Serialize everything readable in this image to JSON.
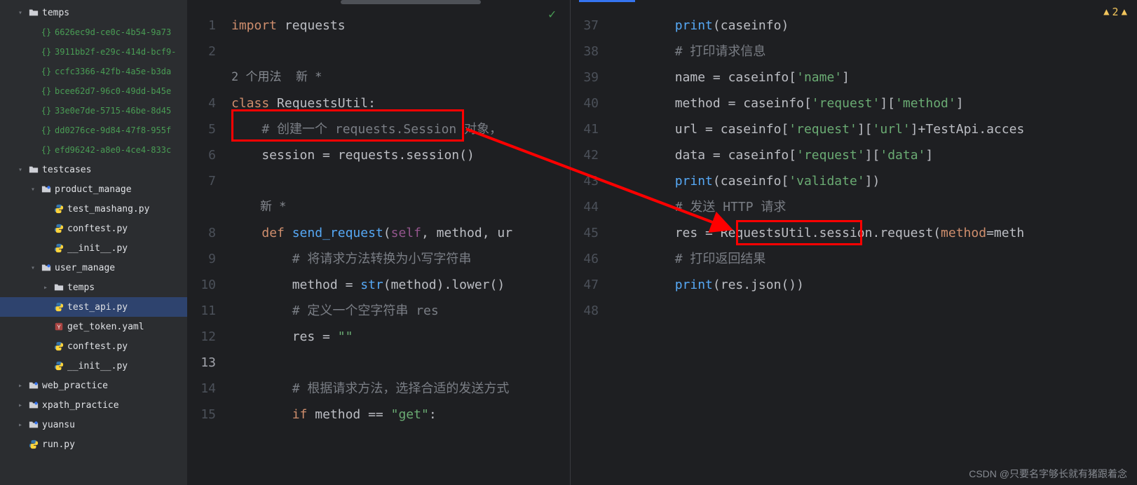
{
  "sidebar": {
    "nodes": [
      {
        "indent": 1,
        "chev": "down",
        "icon": "folder",
        "label": "temps"
      },
      {
        "indent": 2,
        "chev": "",
        "icon": "scratch",
        "label": "6626ec9d-ce0c-4b54-9a73"
      },
      {
        "indent": 2,
        "chev": "",
        "icon": "scratch",
        "label": "3911bb2f-e29c-414d-bcf9-"
      },
      {
        "indent": 2,
        "chev": "",
        "icon": "scratch",
        "label": "ccfc3366-42fb-4a5e-b3da"
      },
      {
        "indent": 2,
        "chev": "",
        "icon": "scratch",
        "label": "bcee62d7-96c0-49dd-b45e"
      },
      {
        "indent": 2,
        "chev": "",
        "icon": "scratch",
        "label": "33e0e7de-5715-46be-8d45"
      },
      {
        "indent": 2,
        "chev": "",
        "icon": "scratch",
        "label": "dd0276ce-9d84-47f8-955f"
      },
      {
        "indent": 2,
        "chev": "",
        "icon": "scratch",
        "label": "efd96242-a8e0-4ce4-833c"
      },
      {
        "indent": 1,
        "chev": "down",
        "icon": "folder",
        "label": "testcases"
      },
      {
        "indent": 2,
        "chev": "down",
        "icon": "pkg",
        "label": "product_manage"
      },
      {
        "indent": 3,
        "chev": "",
        "icon": "py",
        "label": "test_mashang.py"
      },
      {
        "indent": 3,
        "chev": "",
        "icon": "py",
        "label": "conftest.py"
      },
      {
        "indent": 3,
        "chev": "",
        "icon": "py",
        "label": "__init__.py"
      },
      {
        "indent": 2,
        "chev": "down",
        "icon": "pkg",
        "label": "user_manage"
      },
      {
        "indent": 3,
        "chev": "right",
        "icon": "folder",
        "label": "temps"
      },
      {
        "indent": 3,
        "chev": "",
        "icon": "py",
        "label": "test_api.py",
        "selected": true
      },
      {
        "indent": 3,
        "chev": "",
        "icon": "yaml",
        "label": "get_token.yaml"
      },
      {
        "indent": 3,
        "chev": "",
        "icon": "py",
        "label": "conftest.py"
      },
      {
        "indent": 3,
        "chev": "",
        "icon": "py",
        "label": "__init__.py"
      },
      {
        "indent": 1,
        "chev": "right",
        "icon": "pkg",
        "label": "web_practice"
      },
      {
        "indent": 1,
        "chev": "right",
        "icon": "pkg",
        "label": "xpath_practice"
      },
      {
        "indent": 1,
        "chev": "right",
        "icon": "pkg",
        "label": "yuansu"
      },
      {
        "indent": 1,
        "chev": "",
        "icon": "py",
        "label": "run.py"
      }
    ]
  },
  "left_editor": {
    "line_start": 1,
    "current_line": 13,
    "lines": [
      {
        "n": 1,
        "tokens": [
          [
            "kw",
            "import"
          ],
          [
            "id",
            " requests"
          ]
        ]
      },
      {
        "n": 2,
        "tokens": []
      },
      {
        "n": 0,
        "inlay": "2 个用法  新 *"
      },
      {
        "n": 4,
        "tokens": [
          [
            "kw",
            "class"
          ],
          [
            "id",
            " RequestsUtil:"
          ]
        ]
      },
      {
        "n": 5,
        "tokens": [
          [
            "id",
            "    "
          ],
          [
            "cm",
            "# 创建一个 requests.Session 对象，"
          ]
        ]
      },
      {
        "n": 6,
        "tokens": [
          [
            "id",
            "    session "
          ],
          [
            "op",
            "="
          ],
          [
            "id",
            " requests"
          ],
          [
            "op",
            "."
          ],
          [
            "id",
            "session"
          ],
          [
            "op",
            "()"
          ]
        ]
      },
      {
        "n": 7,
        "tokens": []
      },
      {
        "n": 0,
        "inlay": "    新 *"
      },
      {
        "n": 8,
        "tokens": [
          [
            "id",
            "    "
          ],
          [
            "kw",
            "def "
          ],
          [
            "fn",
            "send_request"
          ],
          [
            "op",
            "("
          ],
          [
            "self",
            "self"
          ],
          [
            "op",
            ", "
          ],
          [
            "id",
            "method"
          ],
          [
            "op",
            ", "
          ],
          [
            "id",
            "ur"
          ]
        ]
      },
      {
        "n": 9,
        "tokens": [
          [
            "id",
            "        "
          ],
          [
            "cm",
            "# 将请求方法转换为小写字符串"
          ]
        ]
      },
      {
        "n": 10,
        "tokens": [
          [
            "id",
            "        method "
          ],
          [
            "op",
            "="
          ],
          [
            "id",
            " "
          ],
          [
            "fn",
            "str"
          ],
          [
            "op",
            "("
          ],
          [
            "id",
            "method"
          ],
          [
            "op",
            ")."
          ],
          [
            "id",
            "lower"
          ],
          [
            "op",
            "()"
          ]
        ]
      },
      {
        "n": 11,
        "tokens": [
          [
            "id",
            "        "
          ],
          [
            "cm",
            "# 定义一个空字符串 res"
          ]
        ]
      },
      {
        "n": 12,
        "tokens": [
          [
            "id",
            "        res "
          ],
          [
            "op",
            "="
          ],
          [
            "id",
            " "
          ],
          [
            "str",
            "\"\""
          ]
        ]
      },
      {
        "n": 13,
        "tokens": []
      },
      {
        "n": 14,
        "tokens": [
          [
            "id",
            "        "
          ],
          [
            "cm",
            "# 根据请求方法，选择合适的发送方式"
          ]
        ]
      },
      {
        "n": 15,
        "tokens": [
          [
            "id",
            "        "
          ],
          [
            "kw",
            "if"
          ],
          [
            "id",
            " method "
          ],
          [
            "op",
            "=="
          ],
          [
            "id",
            " "
          ],
          [
            "str",
            "\"get\""
          ],
          [
            "op",
            ":"
          ]
        ]
      }
    ]
  },
  "right_editor": {
    "warning_count": "2",
    "lines": [
      {
        "n": 37,
        "tokens": [
          [
            "id",
            "        "
          ],
          [
            "fn",
            "print"
          ],
          [
            "op",
            "("
          ],
          [
            "id",
            "caseinfo"
          ],
          [
            "op",
            ")"
          ]
        ]
      },
      {
        "n": 38,
        "tokens": [
          [
            "id",
            "        "
          ],
          [
            "cm",
            "# 打印请求信息"
          ]
        ]
      },
      {
        "n": 39,
        "tokens": [
          [
            "id",
            "        "
          ],
          [
            "id",
            "name"
          ],
          [
            "op",
            " = "
          ],
          [
            "id",
            "caseinfo"
          ],
          [
            "op",
            "["
          ],
          [
            "str",
            "'name'"
          ],
          [
            "op",
            "]"
          ]
        ]
      },
      {
        "n": 40,
        "tokens": [
          [
            "id",
            "        "
          ],
          [
            "id",
            "method"
          ],
          [
            "op",
            " = "
          ],
          [
            "id",
            "caseinfo"
          ],
          [
            "op",
            "["
          ],
          [
            "str",
            "'request'"
          ],
          [
            "op",
            "]["
          ],
          [
            "str",
            "'method'"
          ],
          [
            "op",
            "]"
          ]
        ]
      },
      {
        "n": 41,
        "tokens": [
          [
            "id",
            "        "
          ],
          [
            "id",
            "url"
          ],
          [
            "op",
            " = "
          ],
          [
            "id",
            "caseinfo"
          ],
          [
            "op",
            "["
          ],
          [
            "str",
            "'request'"
          ],
          [
            "op",
            "]["
          ],
          [
            "str",
            "'url'"
          ],
          [
            "op",
            "]+"
          ],
          [
            "id",
            "TestApi"
          ],
          [
            "op",
            "."
          ],
          [
            "id",
            "acces"
          ]
        ]
      },
      {
        "n": 42,
        "tokens": [
          [
            "id",
            "        "
          ],
          [
            "id",
            "data"
          ],
          [
            "op",
            " = "
          ],
          [
            "id",
            "caseinfo"
          ],
          [
            "op",
            "["
          ],
          [
            "str",
            "'request'"
          ],
          [
            "op",
            "]["
          ],
          [
            "str",
            "'data'"
          ],
          [
            "op",
            "]"
          ]
        ]
      },
      {
        "n": 43,
        "tokens": [
          [
            "id",
            "        "
          ],
          [
            "fn",
            "print"
          ],
          [
            "op",
            "("
          ],
          [
            "id",
            "caseinfo"
          ],
          [
            "op",
            "["
          ],
          [
            "str",
            "'validate'"
          ],
          [
            "op",
            "])"
          ]
        ]
      },
      {
        "n": 44,
        "tokens": [
          [
            "id",
            "        "
          ],
          [
            "cm",
            "# 发送 HTTP 请求"
          ]
        ]
      },
      {
        "n": 45,
        "tokens": [
          [
            "id",
            "        "
          ],
          [
            "id",
            "res"
          ],
          [
            "op",
            " = "
          ],
          [
            "id",
            "RequestsUtil"
          ],
          [
            "op",
            "."
          ],
          [
            "id",
            "session"
          ],
          [
            "op",
            "."
          ],
          [
            "id",
            "request"
          ],
          [
            "op",
            "("
          ],
          [
            "param",
            "method"
          ],
          [
            "op",
            "="
          ],
          [
            "id",
            "meth"
          ]
        ]
      },
      {
        "n": 46,
        "tokens": [
          [
            "id",
            "        "
          ],
          [
            "cm",
            "# 打印返回结果"
          ]
        ]
      },
      {
        "n": 47,
        "tokens": [
          [
            "id",
            "        "
          ],
          [
            "fn",
            "print"
          ],
          [
            "op",
            "("
          ],
          [
            "id",
            "res"
          ],
          [
            "op",
            "."
          ],
          [
            "id",
            "json"
          ],
          [
            "op",
            "())"
          ]
        ]
      },
      {
        "n": 48,
        "tokens": []
      }
    ]
  },
  "watermark": "CSDN @只要名字够长就有猪跟着念"
}
